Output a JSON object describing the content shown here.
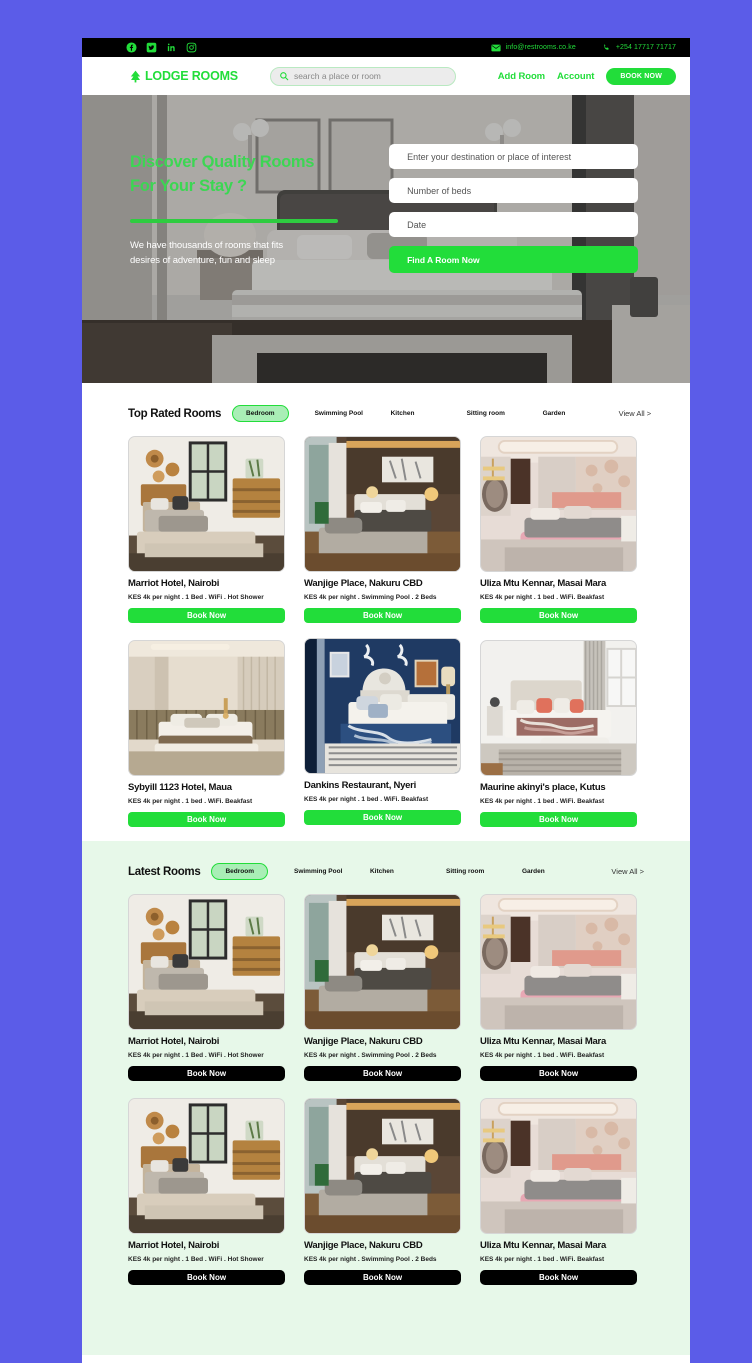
{
  "topbar": {
    "social": [
      {
        "name": "facebook-icon",
        "label": "Facebook"
      },
      {
        "name": "twitter-icon",
        "label": "Twitter"
      },
      {
        "name": "linkedin-icon",
        "label": "LinkedIn"
      },
      {
        "name": "instagram-icon",
        "label": "Instagram"
      }
    ],
    "email": "info@restrooms.co.ke",
    "phone": "+254 17717 71717"
  },
  "nav": {
    "brand": "LODGE ROOMS",
    "search_placeholder": "search a place or room",
    "search_value": "",
    "links": [
      {
        "label": "Add Room"
      },
      {
        "label": "Account"
      }
    ],
    "cta": "BOOK NOW"
  },
  "hero": {
    "title_line1": "Discover Quality Rooms",
    "title_line2": "For Your Stay ?",
    "subtitle_line1": "We have thousands of rooms that fits",
    "subtitle_line2": "desires of adventure, fun and sleep",
    "fields": [
      {
        "placeholder": "Enter your destination or place of interest",
        "value": ""
      },
      {
        "placeholder": "Number of beds",
        "value": ""
      },
      {
        "placeholder": "Date",
        "value": ""
      }
    ],
    "cta": "Find A Room Now"
  },
  "colors": {
    "brand_green": "#22dd3a",
    "page_bg": "#5B5CE8",
    "latest_bg": "#e7f8e9",
    "pill_bg": "#a9eeb6",
    "dark": "#000000"
  },
  "sections": [
    {
      "id": "top-rated",
      "title": "Top Rated Rooms",
      "active_tab": "Bedroom",
      "tabs": [
        "Swimming Pool",
        "Kitchen",
        "Sitting room",
        "Garden"
      ],
      "view_all": "View All >",
      "button_style": "green",
      "rows": [
        [
          {
            "title": "Marriot Hotel, Nairobi",
            "meta": "KES 4k per night . 1 Bed . WiFi . Hot Shower",
            "button": "Book Now",
            "image": "bedroom-wood-window"
          },
          {
            "title": "Wanjige Place, Nakuru CBD",
            "meta": "KES 4k per night . Swimming Pool .  2 Beds",
            "button": "Book Now",
            "image": "bedroom-modern-dark"
          },
          {
            "title": "Uliza Mtu Kennar, Masai Mara",
            "meta": "KES 4k per night . 1 bed . WiFi. Beakfast",
            "button": "Book Now",
            "image": "bedroom-pink"
          }
        ],
        [
          {
            "title": "Sybyill 1123 Hotel, Maua",
            "meta": "KES 4k per night . 1 bed . WiFi. Beakfast",
            "button": "Book Now",
            "image": "bedroom-beige-panel"
          },
          {
            "title": "Dankins Restaurant, Nyeri",
            "meta": "KES 4k per night . 1 bed . WiFi. Beakfast",
            "button": "Book Now",
            "image": "bedroom-navy"
          },
          {
            "title": "Maurine akinyi's place, Kutus",
            "meta": "KES 4k per night . 1 bed . WiFi. Beakfast",
            "button": "Book Now",
            "image": "bedroom-white-coral"
          }
        ]
      ]
    },
    {
      "id": "latest",
      "title": "Latest Rooms",
      "active_tab": "Bedroom",
      "tabs": [
        "Swimming Pool",
        "Kitchen",
        "Sitting room",
        "Garden"
      ],
      "view_all": "View All >",
      "button_style": "black",
      "rows": [
        [
          {
            "title": "Marriot Hotel, Nairobi",
            "meta": "KES 4k per night . 1 Bed . WiFi . Hot Shower",
            "button": "Book Now",
            "image": "bedroom-wood-window"
          },
          {
            "title": "Wanjige Place, Nakuru CBD",
            "meta": "KES 4k per night . Swimming Pool .  2 Beds",
            "button": "Book Now",
            "image": "bedroom-modern-dark"
          },
          {
            "title": "Uliza Mtu Kennar, Masai Mara",
            "meta": "KES 4k per night . 1 bed . WiFi. Beakfast",
            "button": "Book Now",
            "image": "bedroom-pink"
          }
        ],
        [
          {
            "title": "Marriot Hotel, Nairobi",
            "meta": "KES 4k per night . 1 Bed . WiFi . Hot Shower",
            "button": "Book Now",
            "image": "bedroom-wood-window"
          },
          {
            "title": "Wanjige Place, Nakuru CBD",
            "meta": "KES 4k per night . Swimming Pool .  2 Beds",
            "button": "Book Now",
            "image": "bedroom-modern-dark"
          },
          {
            "title": "Uliza Mtu Kennar, Masai Mara",
            "meta": "KES 4k per night . 1 bed . WiFi. Beakfast",
            "button": "Book Now",
            "image": "bedroom-pink"
          }
        ]
      ]
    }
  ]
}
